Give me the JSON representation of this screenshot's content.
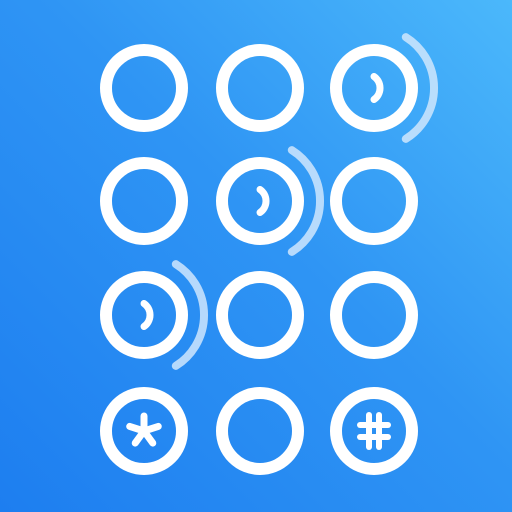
{
  "app_icon": {
    "name": "keypad-app-icon",
    "background_colors": [
      "#4bb8fb",
      "#1d7ef0"
    ],
    "ring_color": "#ffffff",
    "wave_color": "#cfe6fd",
    "keys": [
      {
        "row": 1,
        "col": 1,
        "symbol": "",
        "sound": false
      },
      {
        "row": 1,
        "col": 2,
        "symbol": "",
        "sound": false
      },
      {
        "row": 1,
        "col": 3,
        "symbol": "",
        "sound": true
      },
      {
        "row": 2,
        "col": 1,
        "symbol": "",
        "sound": false
      },
      {
        "row": 2,
        "col": 2,
        "symbol": "",
        "sound": true
      },
      {
        "row": 2,
        "col": 3,
        "symbol": "",
        "sound": false
      },
      {
        "row": 3,
        "col": 1,
        "symbol": "",
        "sound": true
      },
      {
        "row": 3,
        "col": 2,
        "symbol": "",
        "sound": false
      },
      {
        "row": 3,
        "col": 3,
        "symbol": "",
        "sound": false
      },
      {
        "row": 4,
        "col": 1,
        "symbol": "*",
        "sound": false
      },
      {
        "row": 4,
        "col": 2,
        "symbol": "",
        "sound": false
      },
      {
        "row": 4,
        "col": 3,
        "symbol": "#",
        "sound": false
      }
    ]
  }
}
